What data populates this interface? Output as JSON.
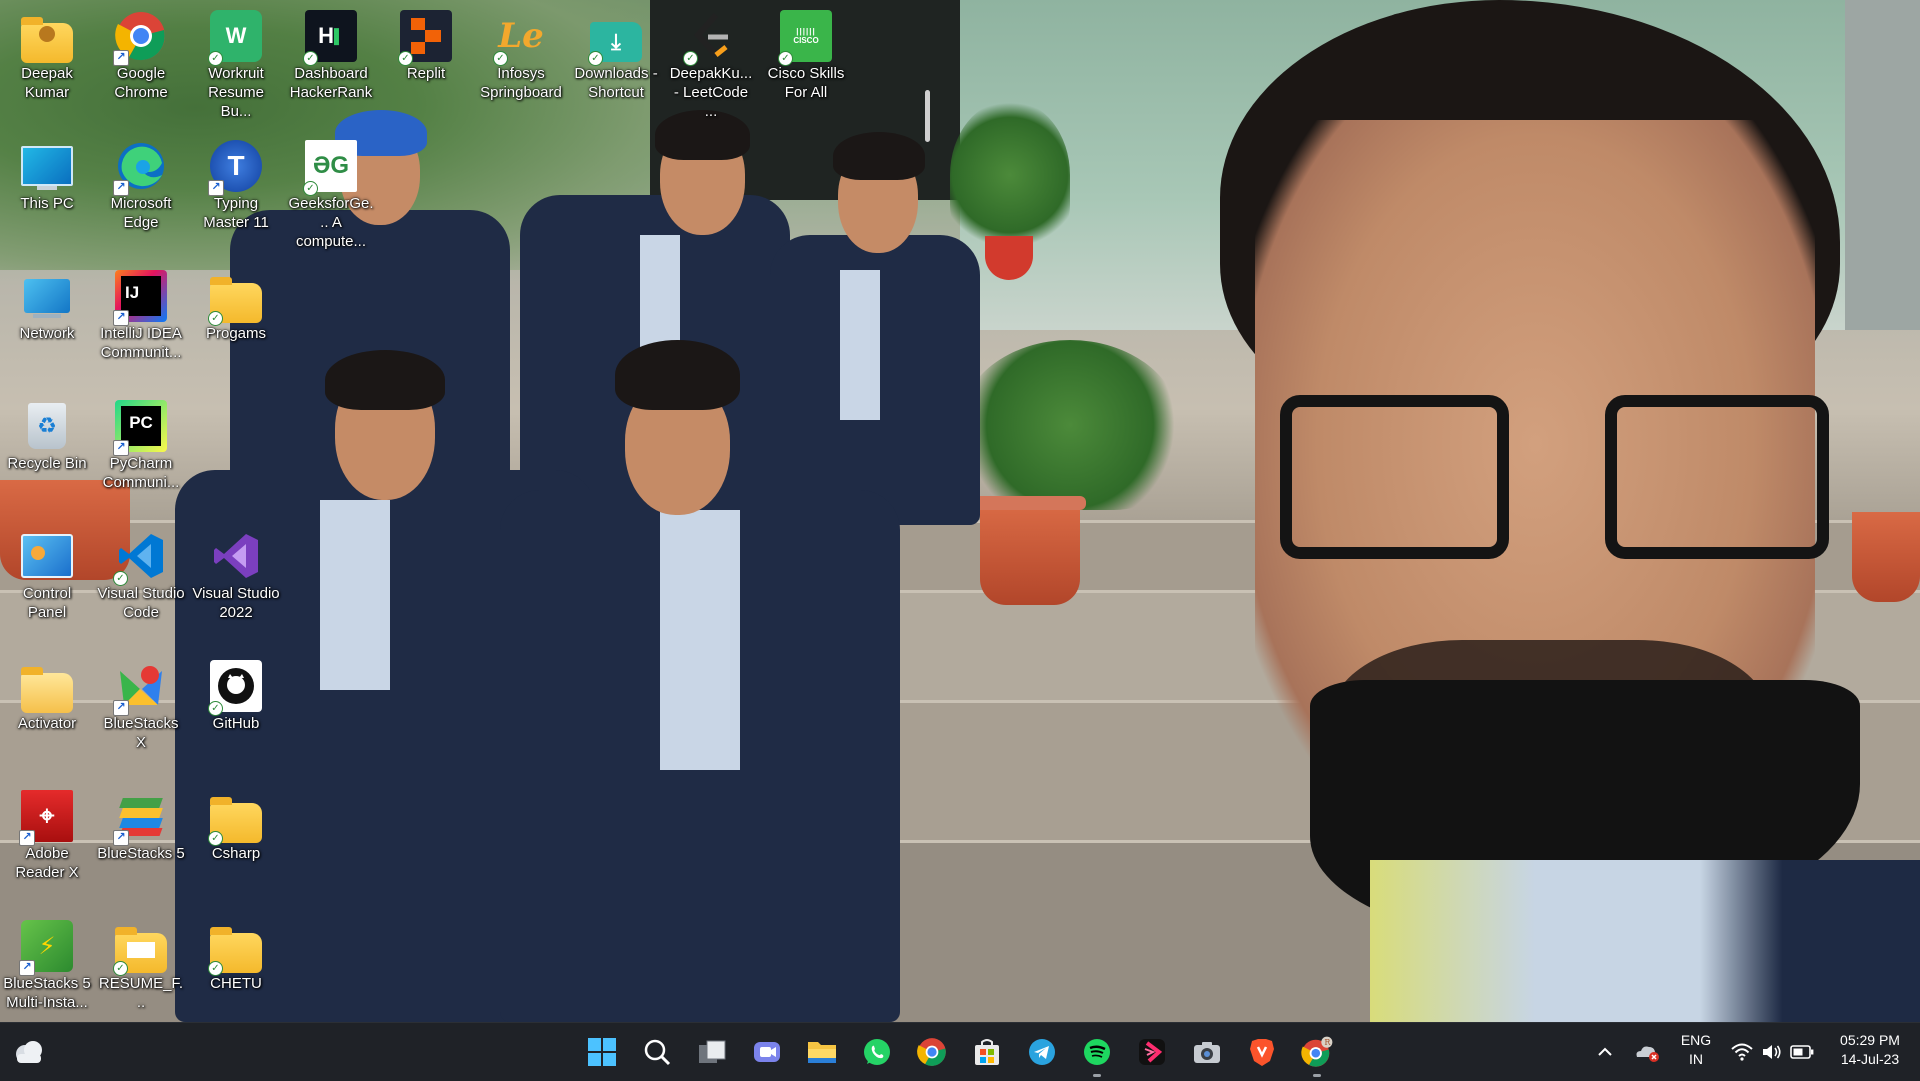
{
  "desktop": {
    "icons": [
      {
        "label": "Deepak Kumar",
        "icon": "user-folder-icon",
        "badge": ""
      },
      {
        "label": "Google Chrome",
        "icon": "chrome-icon",
        "badge": "shortcut"
      },
      {
        "label": "Workruit Resume Bu...",
        "icon": "workruit-icon",
        "badge": "sync"
      },
      {
        "label": "Dashboard HackerRank",
        "icon": "hackerrank-icon",
        "badge": "sync"
      },
      {
        "label": "Replit",
        "icon": "replit-icon",
        "badge": "sync"
      },
      {
        "label": "Infosys Springboard",
        "icon": "infosys-springboard-icon",
        "badge": "sync"
      },
      {
        "label": "Downloads - Shortcut",
        "icon": "downloads-icon",
        "badge": "sync"
      },
      {
        "label": "DeepakKu... - LeetCode ...",
        "icon": "leetcode-icon",
        "badge": "sync"
      },
      {
        "label": "Cisco Skills For All",
        "icon": "cisco-icon",
        "badge": "sync"
      },
      {
        "label": "This PC",
        "icon": "this-pc-icon",
        "badge": ""
      },
      {
        "label": "Microsoft Edge",
        "icon": "edge-icon",
        "badge": "shortcut"
      },
      {
        "label": "Typing Master 11",
        "icon": "typing-master-icon",
        "badge": "shortcut"
      },
      {
        "label": "GeeksforGe... A compute...",
        "icon": "geeksforgeeks-icon",
        "badge": "sync"
      },
      {
        "label": "Network",
        "icon": "network-icon",
        "badge": ""
      },
      {
        "label": "IntelliJ IDEA Communit...",
        "icon": "intellij-icon",
        "badge": "shortcut"
      },
      {
        "label": "Progams",
        "icon": "folder-icon",
        "badge": "sync"
      },
      {
        "label": "Recycle Bin",
        "icon": "recycle-bin-icon",
        "badge": ""
      },
      {
        "label": "PyCharm Communi...",
        "icon": "pycharm-icon",
        "badge": "shortcut"
      },
      {
        "label": "Control Panel",
        "icon": "control-panel-icon",
        "badge": ""
      },
      {
        "label": "Visual Studio Code",
        "icon": "vscode-icon",
        "badge": "sync"
      },
      {
        "label": "Visual Studio 2022",
        "icon": "visual-studio-icon",
        "badge": ""
      },
      {
        "label": "Activator",
        "icon": "activator-folder-icon",
        "badge": ""
      },
      {
        "label": "BlueStacks X",
        "icon": "bluestacks-x-icon",
        "badge": "shortcut"
      },
      {
        "label": "GitHub",
        "icon": "github-icon",
        "badge": "sync"
      },
      {
        "label": "Adobe Reader X",
        "icon": "adobe-reader-icon",
        "badge": "shortcut"
      },
      {
        "label": "BlueStacks 5",
        "icon": "bluestacks5-icon",
        "badge": "shortcut"
      },
      {
        "label": "Csharp",
        "icon": "folder-icon",
        "badge": "sync"
      },
      {
        "label": "BlueStacks 5 Multi-Insta...",
        "icon": "bluestacks-multi-icon",
        "badge": "shortcut"
      },
      {
        "label": "RESUME_F...",
        "icon": "resume-folder-icon",
        "badge": "sync"
      },
      {
        "label": "CHETU",
        "icon": "folder-icon",
        "badge": "sync"
      }
    ]
  },
  "taskbar": {
    "weather_icon": "weather-cloud-icon",
    "apps": [
      {
        "name": "start",
        "icon": "windows-start-icon"
      },
      {
        "name": "search",
        "icon": "search-icon"
      },
      {
        "name": "task-view",
        "icon": "task-view-icon"
      },
      {
        "name": "teams-chat",
        "icon": "teams-chat-icon"
      },
      {
        "name": "file-explorer",
        "icon": "file-explorer-icon"
      },
      {
        "name": "whatsapp",
        "icon": "whatsapp-icon"
      },
      {
        "name": "chrome",
        "icon": "chrome-icon"
      },
      {
        "name": "microsoft-store",
        "icon": "microsoft-store-icon"
      },
      {
        "name": "telegram",
        "icon": "telegram-icon"
      },
      {
        "name": "spotify",
        "icon": "spotify-icon"
      },
      {
        "name": "app-b",
        "icon": "bolt-app-icon"
      },
      {
        "name": "camera",
        "icon": "camera-icon"
      },
      {
        "name": "brave",
        "icon": "brave-icon"
      },
      {
        "name": "chrome-profile",
        "icon": "chrome-profile-icon"
      }
    ],
    "tray": {
      "language_line1": "ENG",
      "language_line2": "IN",
      "time": "05:29 PM",
      "date": "14-Jul-23"
    }
  }
}
